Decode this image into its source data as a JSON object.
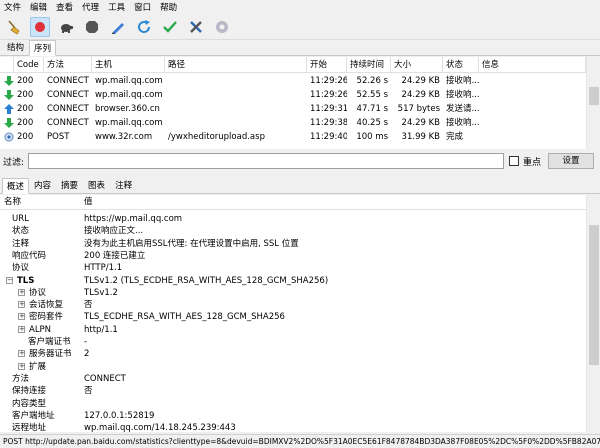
{
  "menu": [
    "文件",
    "编辑",
    "查看",
    "代理",
    "工具",
    "窗口",
    "帮助"
  ],
  "toolbar_icons": [
    "broom-icon",
    "record-icon",
    "turtle-icon",
    "stop-hexagon-icon",
    "pen-icon",
    "refresh-icon",
    "check-icon",
    "tools-icon",
    "gear-icon"
  ],
  "top_tabs": [
    "结构",
    "序列"
  ],
  "columns": [
    "Code",
    "方法",
    "主机",
    "路径",
    "开始",
    "持续时间",
    "大小",
    "状态",
    "信息"
  ],
  "rows": [
    {
      "icon": "download-arrow-icon",
      "code": "200",
      "method": "CONNECT",
      "host": "wp.mail.qq.com",
      "path": "",
      "start": "11:29:26",
      "duration": "52.26 s",
      "size": "24.29 KB",
      "status": "接收响...",
      "info": ""
    },
    {
      "icon": "download-arrow-icon",
      "code": "200",
      "method": "CONNECT",
      "host": "wp.mail.qq.com",
      "path": "",
      "start": "11:29:26",
      "duration": "52.55 s",
      "size": "24.29 KB",
      "status": "接收响...",
      "info": ""
    },
    {
      "icon": "upload-arrow-icon",
      "code": "200",
      "method": "CONNECT",
      "host": "browser.360.cn",
      "path": "",
      "start": "11:29:31",
      "duration": "47.71 s",
      "size": "517 bytes",
      "status": "发送请...",
      "info": ""
    },
    {
      "icon": "download-arrow-icon",
      "code": "200",
      "method": "CONNECT",
      "host": "wp.mail.qq.com",
      "path": "",
      "start": "11:29:38",
      "duration": "40.25 s",
      "size": "24.29 KB",
      "status": "接收响...",
      "info": ""
    },
    {
      "icon": "complete-dot-icon",
      "code": "200",
      "method": "POST",
      "host": "www.32r.com",
      "path": "/ywxheditorupload.asp",
      "start": "11:29:40",
      "duration": "100 ms",
      "size": "31.99 KB",
      "status": "完成",
      "info": ""
    }
  ],
  "filter": {
    "label": "过滤:",
    "value": "",
    "focus_label": "重点",
    "settings_label": "设置"
  },
  "bottom_tabs": [
    "概述",
    "内容",
    "摘要",
    "图表",
    "注释"
  ],
  "detail": {
    "col_name": "名称",
    "col_value": "值",
    "items": [
      {
        "name": "URL",
        "value": "https://wp.mail.qq.com",
        "level": 0,
        "exp": ""
      },
      {
        "name": "状态",
        "value": "接收响应正文...",
        "level": 0,
        "exp": ""
      },
      {
        "name": "注释",
        "value": "没有为此主机启用SSL代理: 在代理设置中启用, SSL 位置",
        "level": 0,
        "exp": ""
      },
      {
        "name": "响应代码",
        "value": "200 连接已建立",
        "level": 0,
        "exp": ""
      },
      {
        "name": "协议",
        "value": "HTTP/1.1",
        "level": 0,
        "exp": ""
      },
      {
        "name": "TLS",
        "value": "TLSv1.2 (TLS_ECDHE_RSA_WITH_AES_128_GCM_SHA256)",
        "level": 0,
        "exp": "−",
        "bold": true
      },
      {
        "name": "协议",
        "value": "TLSv1.2",
        "level": 1,
        "exp": "+"
      },
      {
        "name": "会话恢复",
        "value": "否",
        "level": 1,
        "exp": "+"
      },
      {
        "name": "密码套件",
        "value": "TLS_ECDHE_RSA_WITH_AES_128_GCM_SHA256",
        "level": 1,
        "exp": "+"
      },
      {
        "name": "ALPN",
        "value": "http/1.1",
        "level": 1,
        "exp": "+"
      },
      {
        "name": "客户端证书",
        "value": "-",
        "level": 2,
        "exp": ""
      },
      {
        "name": "服务器证书",
        "value": "2",
        "level": 1,
        "exp": "+"
      },
      {
        "name": "扩展",
        "value": "",
        "level": 1,
        "exp": "+"
      },
      {
        "name": "方法",
        "value": "CONNECT",
        "level": 0,
        "exp": ""
      },
      {
        "name": "保持连接",
        "value": "否",
        "level": 0,
        "exp": ""
      },
      {
        "name": "内容类型",
        "value": "",
        "level": 0,
        "exp": ""
      },
      {
        "name": "客户端地址",
        "value": "127.0.0.1:52819",
        "level": 0,
        "exp": ""
      },
      {
        "name": "远程地址",
        "value": "wp.mail.qq.com/14.18.245.239:443",
        "level": 0,
        "exp": ""
      }
    ]
  },
  "status_bar": "POST http://update.pan.baidu.com/statistics?clienttype=8&devuid=BDIMXV2%2DO%5F31A0EC5E61F8478784BD3DA387F08E05%2DC%5F0%2DD%5FB82A07891253001068... 记录"
}
